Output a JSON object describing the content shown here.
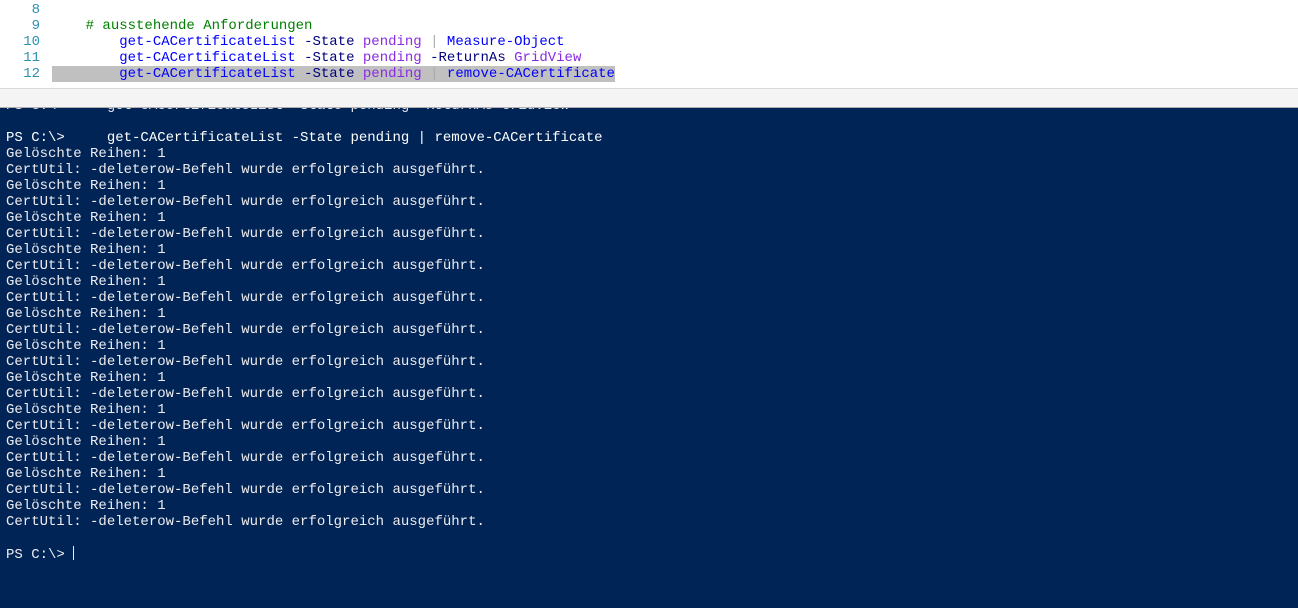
{
  "editor": {
    "lines": [
      {
        "num": "8",
        "segments": []
      },
      {
        "num": "9",
        "segments": [
          {
            "t": "    ",
            "c": ""
          },
          {
            "t": "# ausstehende Anforderungen",
            "c": "tok-comment"
          }
        ]
      },
      {
        "num": "10",
        "segments": [
          {
            "t": "        ",
            "c": ""
          },
          {
            "t": "get-CACertificateList",
            "c": "tok-cmdlet"
          },
          {
            "t": " ",
            "c": ""
          },
          {
            "t": "-State",
            "c": "tok-param"
          },
          {
            "t": " ",
            "c": ""
          },
          {
            "t": "pending",
            "c": "tok-arg"
          },
          {
            "t": " ",
            "c": ""
          },
          {
            "t": "|",
            "c": "tok-op"
          },
          {
            "t": " ",
            "c": ""
          },
          {
            "t": "Measure-Object",
            "c": "tok-cmdlet"
          }
        ]
      },
      {
        "num": "11",
        "segments": [
          {
            "t": "        ",
            "c": ""
          },
          {
            "t": "get-CACertificateList",
            "c": "tok-cmdlet"
          },
          {
            "t": " ",
            "c": ""
          },
          {
            "t": "-State",
            "c": "tok-param"
          },
          {
            "t": " ",
            "c": ""
          },
          {
            "t": "pending",
            "c": "tok-arg"
          },
          {
            "t": " ",
            "c": ""
          },
          {
            "t": "-ReturnAs",
            "c": "tok-param"
          },
          {
            "t": " ",
            "c": ""
          },
          {
            "t": "GridView",
            "c": "tok-arg"
          }
        ]
      },
      {
        "num": "12",
        "segments": [
          {
            "t": "        ",
            "c": "sel"
          },
          {
            "t": "get-CACertificateList",
            "c": "tok-cmdlet sel"
          },
          {
            "t": " ",
            "c": "sel"
          },
          {
            "t": "-State",
            "c": "tok-param sel"
          },
          {
            "t": " ",
            "c": "sel"
          },
          {
            "t": "pending",
            "c": "tok-arg sel"
          },
          {
            "t": " ",
            "c": "sel"
          },
          {
            "t": "|",
            "c": "tok-op sel"
          },
          {
            "t": " ",
            "c": "sel"
          },
          {
            "t": "remove-CACertificate",
            "c": "tok-cmdlet sel"
          }
        ]
      }
    ]
  },
  "console": {
    "cutoff_line": "PS C:\\>     get-CACertificateList -State pending -ReturnAs GridView",
    "blank": "",
    "prompt_line": "PS C:\\>     get-CACertificateList -State pending | remove-CACertificate",
    "repeat_pair": {
      "l1": "Gelöschte Reihen: 1",
      "l2": "CertUtil: -deleterow-Befehl wurde erfolgreich ausgeführt."
    },
    "repeat_count": 12,
    "final_prompt": "PS C:\\> "
  }
}
